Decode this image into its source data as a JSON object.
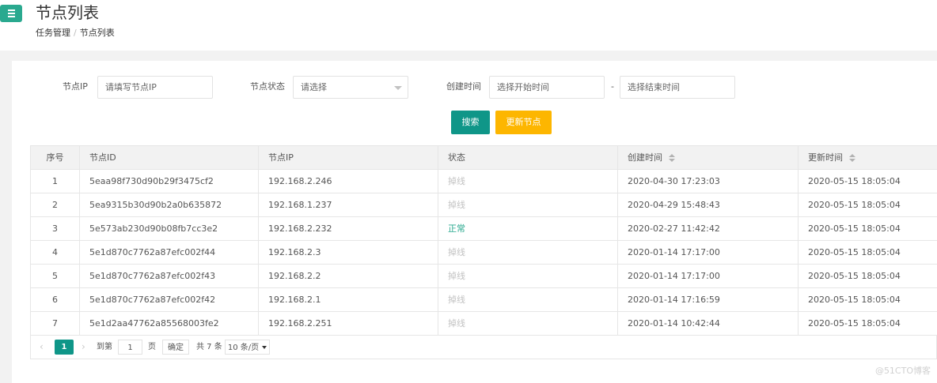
{
  "header": {
    "title": "节点列表",
    "breadcrumb": [
      "任务管理",
      "节点列表"
    ],
    "breadcrumb_sep": "/"
  },
  "filters": {
    "ip_label": "节点IP",
    "ip_placeholder": "请填写节点IP",
    "status_label": "节点状态",
    "status_value": "请选择",
    "created_label": "创建时间",
    "start_placeholder": "选择开始时间",
    "range_sep": "-",
    "end_placeholder": "选择结束时间"
  },
  "buttons": {
    "search": "搜索",
    "update": "更新节点"
  },
  "table": {
    "columns": [
      "序号",
      "节点ID",
      "节点IP",
      "状态",
      "创建时间",
      "更新时间"
    ],
    "rows": [
      {
        "no": "1",
        "id": "5eaa98f730d90b29f3475cf2",
        "ip": "192.168.2.246",
        "status": "掉线",
        "created": "2020-04-30 17:23:03",
        "updated": "2020-05-15 18:05:04"
      },
      {
        "no": "2",
        "id": "5ea9315b30d90b2a0b635872",
        "ip": "192.168.1.237",
        "status": "掉线",
        "created": "2020-04-29 15:48:43",
        "updated": "2020-05-15 18:05:04"
      },
      {
        "no": "3",
        "id": "5e573ab230d90b08fb7cc3e2",
        "ip": "192.168.2.232",
        "status": "正常",
        "created": "2020-02-27 11:42:42",
        "updated": "2020-05-15 18:05:04"
      },
      {
        "no": "4",
        "id": "5e1d870c7762a87efc002f44",
        "ip": "192.168.2.3",
        "status": "掉线",
        "created": "2020-01-14 17:17:00",
        "updated": "2020-05-15 18:05:04"
      },
      {
        "no": "5",
        "id": "5e1d870c7762a87efc002f43",
        "ip": "192.168.2.2",
        "status": "掉线",
        "created": "2020-01-14 17:17:00",
        "updated": "2020-05-15 18:05:04"
      },
      {
        "no": "6",
        "id": "5e1d870c7762a87efc002f42",
        "ip": "192.168.2.1",
        "status": "掉线",
        "created": "2020-01-14 17:16:59",
        "updated": "2020-05-15 18:05:04"
      },
      {
        "no": "7",
        "id": "5e1d2aa47762a85568003fe2",
        "ip": "192.168.2.251",
        "status": "掉线",
        "created": "2020-01-14 10:42:44",
        "updated": "2020-05-15 18:05:04"
      }
    ]
  },
  "pager": {
    "current": "1",
    "goto_label": "到第",
    "goto_value": "1",
    "page_unit": "页",
    "confirm": "确定",
    "total": "共 7 条",
    "page_size": "10 条/页"
  },
  "watermark": "@51CTO博客",
  "colors": {
    "primary": "#0f9688",
    "warning": "#fdb600",
    "menu": "#2aa98f",
    "online": "#2aa98f",
    "offline": "#c2c2c2"
  }
}
